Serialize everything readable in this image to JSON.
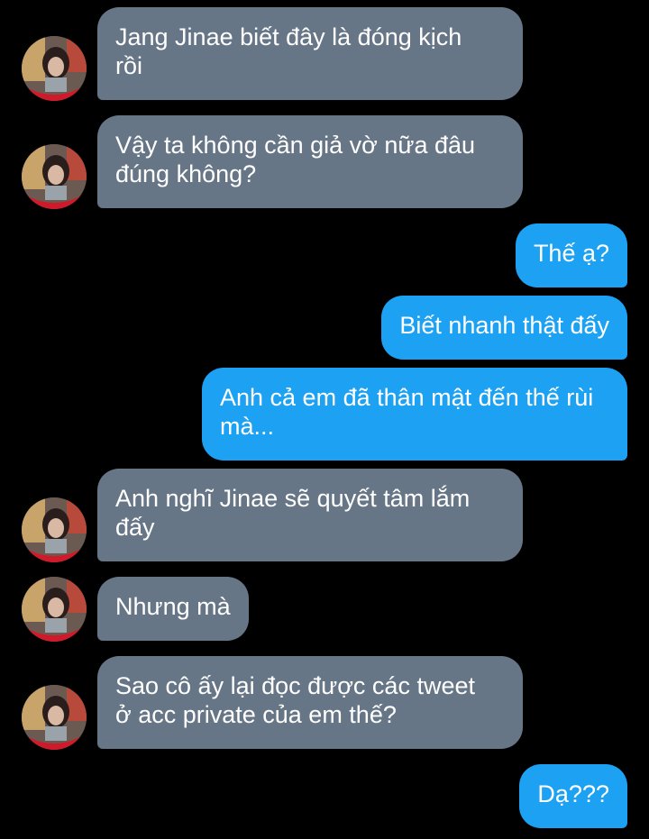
{
  "colors": {
    "background": "#000000",
    "incoming_bubble": "#677686",
    "outgoing_bubble": "#1da1f2",
    "text": "#ffffff"
  },
  "messages": [
    {
      "direction": "incoming",
      "avatar": "contact-avatar",
      "text": "Jang Jinae biết đây là đóng kịch\nrồi"
    },
    {
      "direction": "incoming",
      "avatar": "contact-avatar",
      "text": "Vậy ta không cần giả vờ nữa đâu\nđúng không?"
    },
    {
      "direction": "outgoing",
      "text": "Thế ạ?"
    },
    {
      "direction": "outgoing",
      "text": "Biết nhanh thật đấy"
    },
    {
      "direction": "outgoing",
      "text": "Anh cả em đã thân mật đến thế rùi\nmà..."
    },
    {
      "direction": "incoming",
      "avatar": "contact-avatar",
      "text": "Anh nghĩ Jinae sẽ quyết tâm lắm\nđấy"
    },
    {
      "direction": "incoming",
      "avatar": "contact-avatar",
      "text": "Nhưng mà"
    },
    {
      "direction": "incoming",
      "avatar": "contact-avatar",
      "text": "Sao cô ấy lại đọc được các tweet\nở acc private của em thế?"
    },
    {
      "direction": "outgoing",
      "text": "Dạ???"
    }
  ]
}
